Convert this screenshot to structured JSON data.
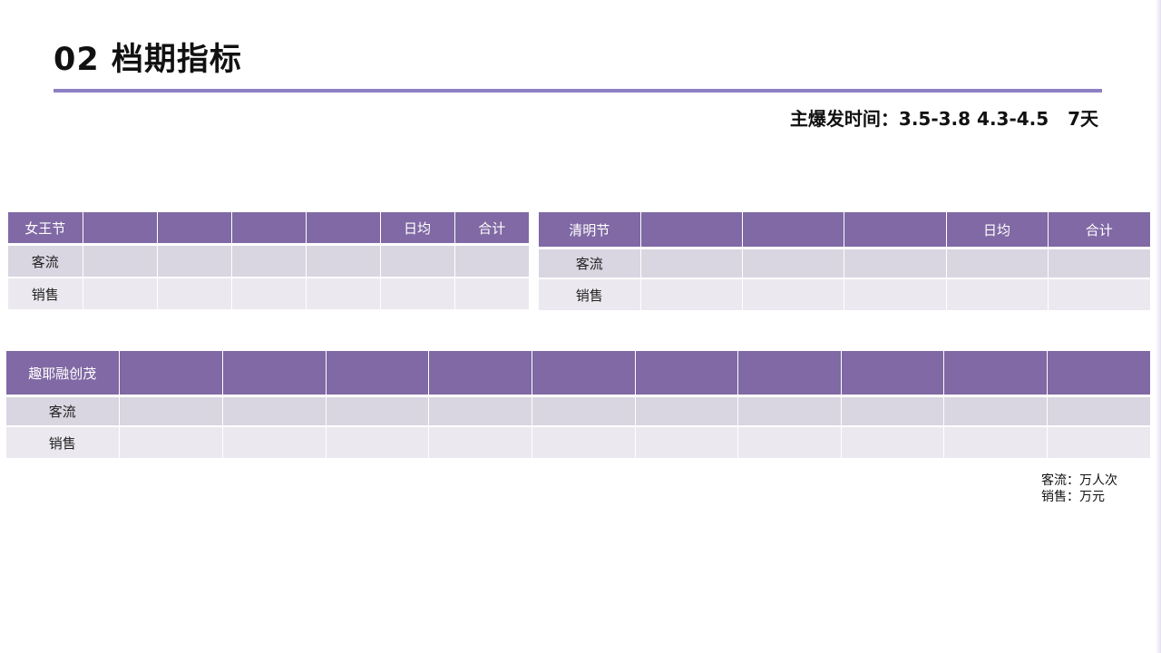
{
  "header": {
    "title": "02 档期指标",
    "subtitle": "主爆发时间：3.5-3.8 4.3-4.5   7天"
  },
  "tables": [
    {
      "name": "女王节",
      "columns": [
        "",
        "",
        "",
        "",
        "日均",
        "合计"
      ],
      "rows": [
        {
          "label": "客流",
          "values": [
            "",
            "",
            "",
            "",
            "",
            ""
          ]
        },
        {
          "label": "销售",
          "values": [
            "",
            "",
            "",
            "",
            "",
            ""
          ]
        }
      ]
    },
    {
      "name": "清明节",
      "columns": [
        "",
        "",
        "",
        "日均",
        "合计"
      ],
      "rows": [
        {
          "label": "客流",
          "values": [
            "",
            "",
            "",
            "",
            ""
          ]
        },
        {
          "label": "销售",
          "values": [
            "",
            "",
            "",
            "",
            ""
          ]
        }
      ]
    },
    {
      "name": "趣耶融创茂",
      "columns": [
        "",
        "",
        "",
        "",
        "",
        "",
        "",
        "",
        "",
        ""
      ],
      "rows": [
        {
          "label": "客流",
          "values": [
            "",
            "",
            "",
            "",
            "",
            "",
            "",
            "",
            "",
            ""
          ]
        },
        {
          "label": "销售",
          "values": [
            "",
            "",
            "",
            "",
            "",
            "",
            "",
            "",
            "",
            ""
          ]
        }
      ]
    }
  ],
  "units": {
    "traffic": "客流：万人次",
    "sales": "销售：万元"
  },
  "colors": {
    "accent": "#8e80c4",
    "header_bg": "#8069a4",
    "row_dark": "#d9d5e1",
    "row_light": "#ebe9ef"
  }
}
